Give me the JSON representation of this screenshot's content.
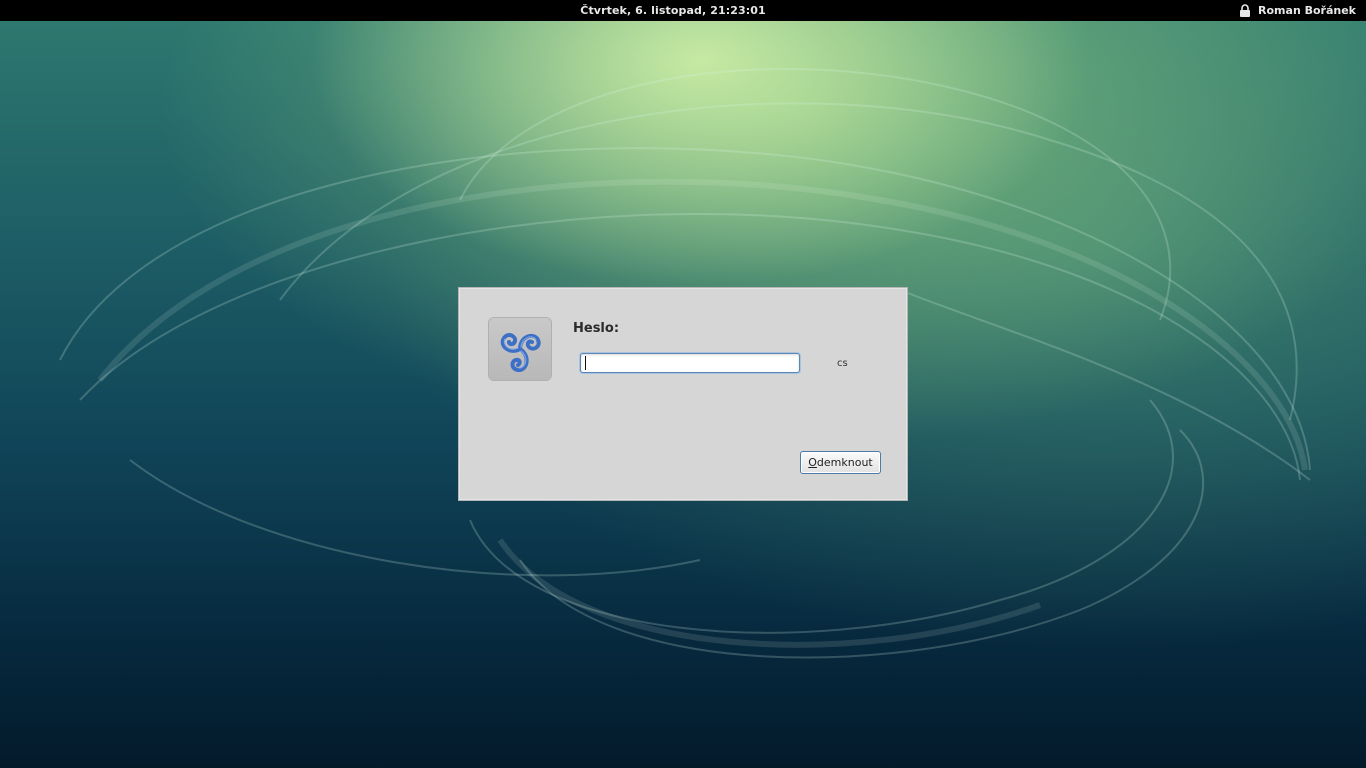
{
  "topbar": {
    "clock": "Čtvrtek,  6. listopad, 21:23:01",
    "user_name": "Roman Bořánek",
    "lock_icon": "lock-icon"
  },
  "dialog": {
    "app_icon": "triskelion-logo-icon",
    "prompt_label": "Heslo:",
    "password_value": "",
    "keyboard_layout": "cs",
    "unlock_button": {
      "mnemonic": "O",
      "rest": "demknout"
    }
  },
  "colors": {
    "topbar_bg": "#000000",
    "dialog_bg": "#d6d6d6",
    "focus_border": "#5a87b4",
    "logo_blue": "#3d6fc4"
  }
}
